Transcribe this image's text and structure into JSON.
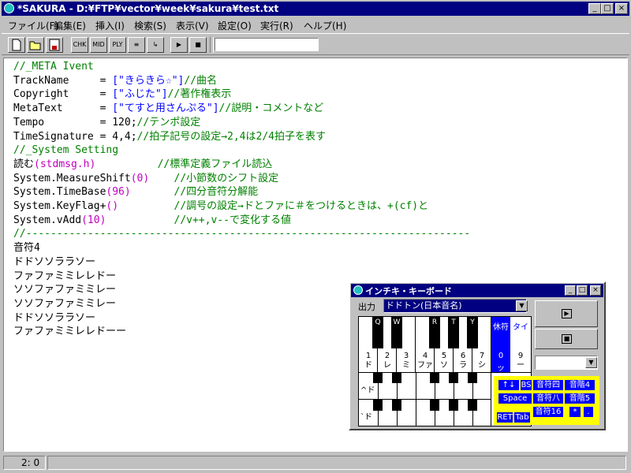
{
  "window": {
    "title": "*SAKURA - D:¥FTP¥vector¥week¥sakura¥test.txt"
  },
  "caption_buttons": {
    "minimize": "_",
    "maximize": "□",
    "close": "×"
  },
  "menu": {
    "items": [
      "ファイル(F)",
      "編集(E)",
      "挿入(I)",
      "検索(S)",
      "表示(V)",
      "設定(O)",
      "実行(R)",
      "ヘルプ(H)"
    ]
  },
  "toolbar": {
    "buttons": [
      "new",
      "open",
      "save",
      "CHK",
      "MID",
      "PLAY",
      "list",
      "export",
      "play",
      "stop"
    ],
    "input_value": ""
  },
  "editor": {
    "lines": [
      [
        {
          "t": "//_META Ivent",
          "c": "green"
        }
      ],
      [
        {
          "t": "TrackName     = ",
          "c": "black"
        },
        {
          "t": "[\"きらきら☆\"]",
          "c": "blue"
        },
        {
          "t": "//曲名",
          "c": "green"
        }
      ],
      [
        {
          "t": "Copyright     = ",
          "c": "black"
        },
        {
          "t": "[\"ふじた\"]",
          "c": "blue"
        },
        {
          "t": "//著作権表示",
          "c": "green"
        }
      ],
      [
        {
          "t": "MetaText      = ",
          "c": "black"
        },
        {
          "t": "[\"てすと用さんぷる\"]",
          "c": "blue"
        },
        {
          "t": "//説明・コメントなど",
          "c": "green"
        }
      ],
      [
        {
          "t": "Tempo         = 120;",
          "c": "black"
        },
        {
          "t": "//テンポ設定",
          "c": "green"
        }
      ],
      [
        {
          "t": "TimeSignature = 4,4;",
          "c": "black"
        },
        {
          "t": "//拍子記号の設定→2,4は2/4拍子を表す",
          "c": "green"
        }
      ],
      [
        {
          "t": "//_System Setting",
          "c": "green"
        }
      ],
      [
        {
          "t": "読む",
          "c": "black"
        },
        {
          "t": "(stdmsg.h)",
          "c": "magenta"
        },
        {
          "t": "          ",
          "c": "black"
        },
        {
          "t": "//標準定義ファイル読込",
          "c": "green"
        }
      ],
      [
        {
          "t": "System.MeasureShift",
          "c": "black"
        },
        {
          "t": "(0)",
          "c": "magenta"
        },
        {
          "t": "    ",
          "c": "black"
        },
        {
          "t": "//小節数のシフト設定",
          "c": "green"
        }
      ],
      [
        {
          "t": "System.TimeBase",
          "c": "black"
        },
        {
          "t": "(96)",
          "c": "magenta"
        },
        {
          "t": "       ",
          "c": "black"
        },
        {
          "t": "//四分音符分解能",
          "c": "green"
        }
      ],
      [
        {
          "t": "System.KeyFlag+",
          "c": "black"
        },
        {
          "t": "()",
          "c": "magenta"
        },
        {
          "t": "         ",
          "c": "black"
        },
        {
          "t": "//調号の設定→ドとファに＃をつけるときは、+(cf)と",
          "c": "green"
        }
      ],
      [
        {
          "t": "System.vAdd",
          "c": "black"
        },
        {
          "t": "(10)",
          "c": "magenta"
        },
        {
          "t": "           ",
          "c": "black"
        },
        {
          "t": "//v++,v--で変化する値",
          "c": "green"
        }
      ],
      [
        {
          "t": "//------------------------------------------------------------------------",
          "c": "green"
        }
      ],
      [
        {
          "t": "音符4",
          "c": "black"
        }
      ],
      [
        {
          "t": "ドドソソララソー",
          "c": "black"
        }
      ],
      [
        {
          "t": "ファファミミレレドー",
          "c": "black"
        }
      ],
      [
        {
          "t": "ソソファファミミレー",
          "c": "black"
        }
      ],
      [
        {
          "t": "ソソファファミミレー",
          "c": "black"
        }
      ],
      [
        {
          "t": "ドドソソララソー",
          "c": "black"
        }
      ],
      [
        {
          "t": "ファファミミレレドーー",
          "c": "black"
        }
      ]
    ]
  },
  "status": {
    "position": "2:  0"
  },
  "keyboard_window": {
    "title": "インチキ・キーボード",
    "output_label": "出力",
    "output_value": "ドドトン(日本音名)",
    "black_keys": [
      "Q",
      "W",
      "R",
      "T",
      "Y"
    ],
    "white_keys": [
      {
        "num": "1",
        "name": "ド"
      },
      {
        "num": "2",
        "name": "レ"
      },
      {
        "num": "3",
        "name": "ミ"
      },
      {
        "num": "4",
        "name": "ファ"
      },
      {
        "num": "5",
        "name": "ソ"
      },
      {
        "num": "6",
        "name": "ラ"
      },
      {
        "num": "7",
        "name": "シ"
      }
    ],
    "rest_key": {
      "top": "休符",
      "num": "0",
      "name": "ッ"
    },
    "tie_key": {
      "top": "タイ",
      "num": "9",
      "name": "ー"
    },
    "piano_labels": [
      "^ド",
      "`ド"
    ],
    "help": {
      "arrows": "↑↓",
      "bs": "BS",
      "space": "Space",
      "ret": "RET",
      "tab": "Tab",
      "note4": "音符四",
      "note8": "音符八",
      "note16": "音符16",
      "scale4": "音階4",
      "scale5": "音階5",
      "star": "*",
      "dot": "."
    },
    "color_accent": "#0000ff",
    "color_help_bg": "#ffff00"
  }
}
